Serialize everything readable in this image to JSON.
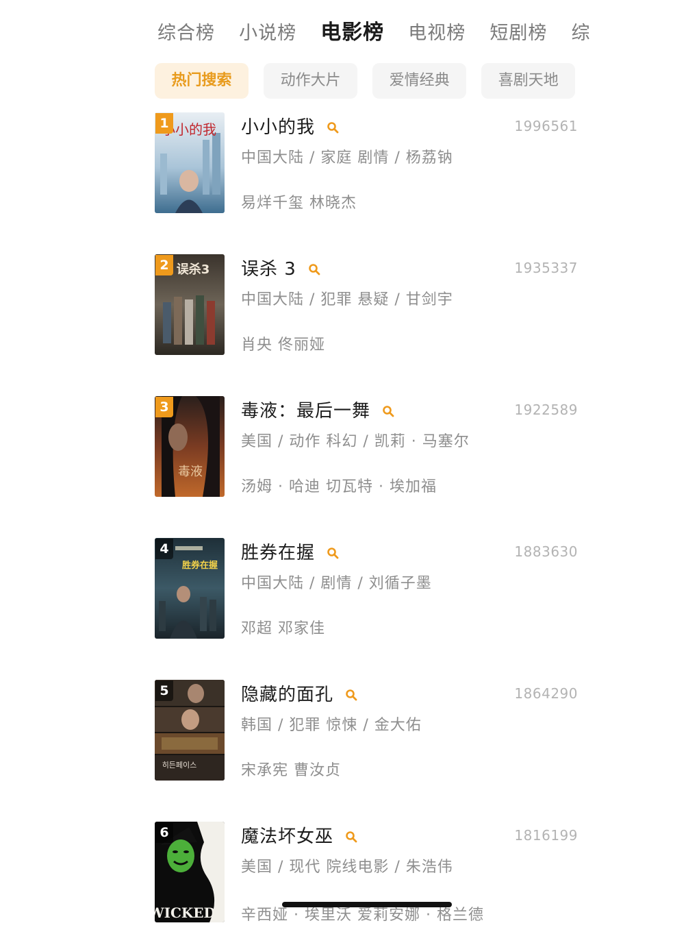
{
  "top_tabs": [
    "综合榜",
    "小说榜",
    "电影榜",
    "电视榜",
    "短剧榜",
    "综"
  ],
  "active_top_tab": 2,
  "chips": [
    "热门搜索",
    "动作大片",
    "爱情经典",
    "喜剧天地"
  ],
  "active_chip": 0,
  "accent_color": "#ef9a1c",
  "items": [
    {
      "rank": "1",
      "title": "小小的我",
      "count": "1996561",
      "meta": "中国大陆 / 家庭 剧情 / 杨荔钠",
      "cast": "易烊千玺 林晓杰"
    },
    {
      "rank": "2",
      "title": "误杀 3",
      "count": "1935337",
      "meta": "中国大陆 / 犯罪 悬疑 / 甘剑宇",
      "cast": "肖央 佟丽娅"
    },
    {
      "rank": "3",
      "title": "毒液：最后一舞",
      "count": "1922589",
      "meta": "美国 / 动作 科幻 / 凯莉 · 马塞尔",
      "cast": "汤姆 · 哈迪    切瓦特 · 埃加福"
    },
    {
      "rank": "4",
      "title": "胜券在握",
      "count": "1883630",
      "meta": "中国大陆 / 剧情 / 刘循子墨",
      "cast": "邓超 邓家佳"
    },
    {
      "rank": "5",
      "title": "隐藏的面孔",
      "count": "1864290",
      "meta": "韩国 / 犯罪 惊悚 / 金大佑",
      "cast": "宋承宪 曹汝贞"
    },
    {
      "rank": "6",
      "title": "魔法坏女巫",
      "count": "1816199",
      "meta": "美国 / 现代 院线电影 / 朱浩伟",
      "cast": "辛西娅 · 埃里沃 爱莉安娜 · 格兰德"
    }
  ],
  "poster_texts": [
    "小小的我",
    "误杀3",
    "毒液",
    "胜券在握",
    "히든페이스",
    "WICKED"
  ]
}
